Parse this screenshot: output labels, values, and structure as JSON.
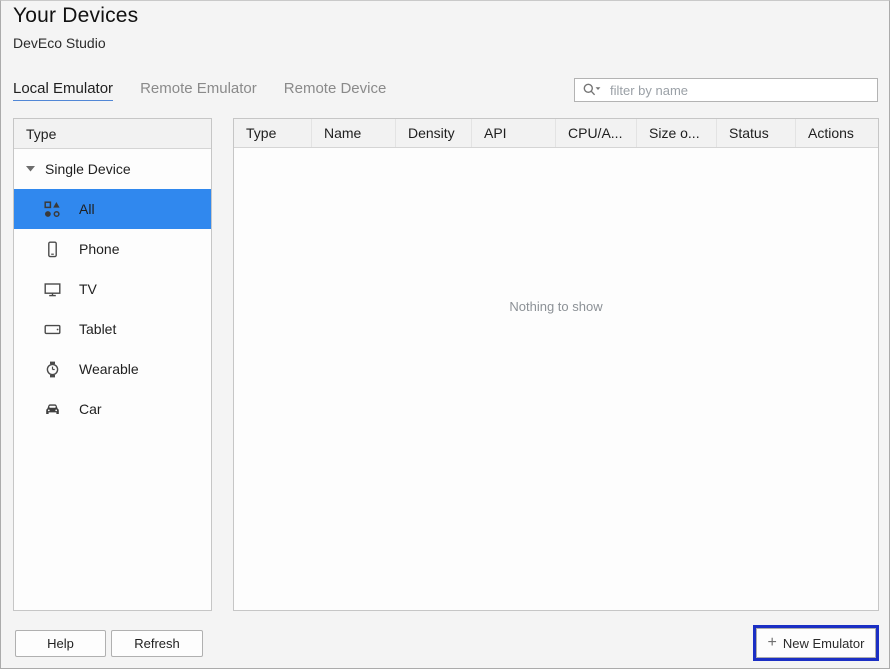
{
  "window": {
    "title": "Your Devices",
    "subtitle": "DevEco Studio"
  },
  "tabs": [
    {
      "label": "Local Emulator",
      "active": true
    },
    {
      "label": "Remote Emulator",
      "active": false
    },
    {
      "label": "Remote Device",
      "active": false
    }
  ],
  "search": {
    "placeholder": "filter by name",
    "icon": "search-with-dropdown-icon"
  },
  "sidebar": {
    "header": "Type",
    "group": {
      "label": "Single Device",
      "expanded": true,
      "icon": "chevron-down-icon"
    },
    "items": [
      {
        "icon": "all-devices-icon",
        "label": "All",
        "selected": true
      },
      {
        "icon": "phone-icon",
        "label": "Phone",
        "selected": false
      },
      {
        "icon": "tv-icon",
        "label": "TV",
        "selected": false
      },
      {
        "icon": "tablet-icon",
        "label": "Tablet",
        "selected": false
      },
      {
        "icon": "wearable-icon",
        "label": "Wearable",
        "selected": false
      },
      {
        "icon": "car-icon",
        "label": "Car",
        "selected": false
      }
    ]
  },
  "table": {
    "columns": [
      "Type",
      "Name",
      "Density",
      "API",
      "CPU/A...",
      "Size o...",
      "Status",
      "Actions"
    ],
    "rows": [],
    "empty_text": "Nothing to show"
  },
  "footer": {
    "help_label": "Help",
    "refresh_label": "Refresh",
    "plus_label": "+",
    "new_emulator_label": "New Emulator"
  },
  "colors": {
    "selection_blue": "#3088ee",
    "focus_ring_blue": "#1b2fc4",
    "tab_underline_blue": "#5187d6",
    "panel_border": "#c6c6c6",
    "header_bg": "#f2f2f2",
    "dialog_bg": "#f4f4f4"
  }
}
